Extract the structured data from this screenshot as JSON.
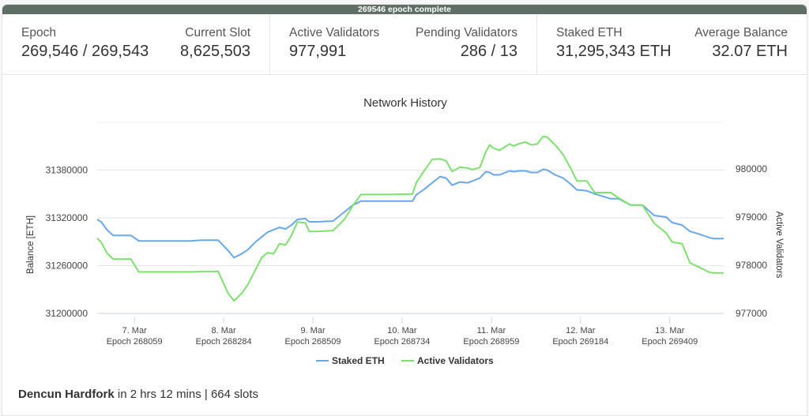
{
  "banner": {
    "text": "269546 epoch complete"
  },
  "stats": {
    "epoch": {
      "label": "Epoch",
      "value": "269,546 / 269,543"
    },
    "current_slot": {
      "label": "Current Slot",
      "value": "8,625,503"
    },
    "active_validators": {
      "label": "Active Validators",
      "value": "977,991"
    },
    "pending_validators": {
      "label": "Pending Validators",
      "value": "286 / 13"
    },
    "staked_eth": {
      "label": "Staked ETH",
      "value": "31,295,343 ETH"
    },
    "average_balance": {
      "label": "Average Balance",
      "value": "32.07 ETH"
    }
  },
  "footer": {
    "event": "Dencun Hardfork",
    "countdown": " in 2 hrs 12 mins",
    "separator": " | ",
    "slots": "664 slots"
  },
  "chart_data": {
    "type": "line",
    "title": "Network History",
    "xlabel": "",
    "ylabel": "Balance [ETH]",
    "y2label": "Active Validators",
    "grid": true,
    "legend_position": "bottom-center",
    "x_ticks": [
      {
        "date": "7. Mar",
        "epoch": "Epoch 268059",
        "value": 268059
      },
      {
        "date": "8. Mar",
        "epoch": "Epoch 268284",
        "value": 268284
      },
      {
        "date": "9. Mar",
        "epoch": "Epoch 268509",
        "value": 268509
      },
      {
        "date": "10. Mar",
        "epoch": "Epoch 268734",
        "value": 268734
      },
      {
        "date": "11. Mar",
        "epoch": "Epoch 268959",
        "value": 268959
      },
      {
        "date": "12. Mar",
        "epoch": "Epoch 269184",
        "value": 269184
      },
      {
        "date": "13. Mar",
        "epoch": "Epoch 269409",
        "value": 269409
      }
    ],
    "xlim": [
      267965,
      269545
    ],
    "ylim": [
      31195000,
      31440000
    ],
    "y_ticks": [
      31200000,
      31260000,
      31320000,
      31380000
    ],
    "y2lim": [
      976917,
      980970
    ],
    "y2_ticks": [
      977000,
      978000,
      979000,
      980000
    ],
    "series": [
      {
        "name": "Staked ETH",
        "axis": "left",
        "color": "#6aa7e8",
        "x": [
          267965,
          267975,
          267990,
          268005,
          268020,
          268050,
          268070,
          268090,
          268140,
          268200,
          268230,
          268270,
          268295,
          268310,
          268330,
          268345,
          268365,
          268380,
          268395,
          268410,
          268425,
          268440,
          268455,
          268470,
          268490,
          268500,
          268520,
          268560,
          268570,
          268590,
          268610,
          268630,
          268650,
          268670,
          268700,
          268760,
          268770,
          268790,
          268810,
          268830,
          268845,
          268860,
          268880,
          268900,
          268910,
          268930,
          268945,
          268955,
          268965,
          268980,
          269005,
          269015,
          269030,
          269045,
          269060,
          269075,
          269090,
          269100,
          269120,
          269140,
          269160,
          269175,
          269185,
          269200,
          269220,
          269260,
          269280,
          269310,
          269340,
          269370,
          269400,
          269415,
          269440,
          269460,
          269480,
          269510,
          269520,
          269545
        ],
        "values": [
          31318000,
          31315000,
          31305000,
          31298000,
          31298000,
          31298000,
          31291000,
          31291000,
          31291000,
          31291000,
          31292000,
          31292000,
          31279000,
          31270000,
          31275000,
          31280000,
          31290000,
          31296000,
          31302000,
          31305000,
          31308000,
          31306000,
          31311000,
          31318000,
          31319000,
          31315000,
          31315000,
          31316000,
          31320000,
          31328000,
          31336000,
          31341000,
          31341000,
          31341000,
          31341000,
          31341000,
          31349000,
          31356000,
          31364000,
          31372000,
          31370000,
          31361000,
          31365000,
          31364000,
          31366000,
          31370000,
          31378000,
          31377000,
          31374000,
          31374000,
          31379000,
          31378000,
          31379000,
          31379000,
          31377000,
          31377000,
          31381000,
          31380000,
          31374000,
          31370000,
          31362000,
          31355000,
          31355000,
          31354000,
          31350000,
          31344000,
          31344000,
          31336000,
          31336000,
          31323000,
          31321000,
          31314000,
          31311000,
          31303000,
          31300000,
          31295000,
          31294000,
          31294000
        ]
      },
      {
        "name": "Active Validators",
        "axis": "right",
        "color": "#7ee06e",
        "x": [
          267965,
          267975,
          267990,
          268005,
          268020,
          268050,
          268070,
          268090,
          268140,
          268200,
          268230,
          268270,
          268295,
          268310,
          268330,
          268345,
          268365,
          268380,
          268395,
          268410,
          268425,
          268440,
          268455,
          268470,
          268490,
          268500,
          268520,
          268560,
          268570,
          268590,
          268610,
          268630,
          268650,
          268670,
          268700,
          268760,
          268770,
          268790,
          268810,
          268830,
          268845,
          268860,
          268880,
          268900,
          268910,
          268930,
          268945,
          268955,
          268965,
          268980,
          269005,
          269015,
          269030,
          269045,
          269060,
          269075,
          269090,
          269100,
          269120,
          269140,
          269160,
          269175,
          269185,
          269200,
          269220,
          269260,
          269280,
          269310,
          269340,
          269370,
          269400,
          269415,
          269440,
          269460,
          269480,
          269510,
          269520,
          269545
        ],
        "values": [
          978560,
          978480,
          978250,
          978130,
          978130,
          978130,
          977860,
          977860,
          977860,
          977860,
          977870,
          977870,
          977420,
          977260,
          977420,
          977600,
          977920,
          978160,
          978260,
          978240,
          978450,
          978420,
          978620,
          978900,
          978880,
          978700,
          978700,
          978720,
          978800,
          978970,
          979240,
          979470,
          979470,
          979470,
          979470,
          979480,
          979720,
          979970,
          980200,
          980210,
          980170,
          979950,
          980040,
          980020,
          979990,
          980030,
          980360,
          980500,
          980430,
          980390,
          980520,
          980480,
          980530,
          980560,
          980500,
          980520,
          980680,
          980660,
          980500,
          980300,
          980000,
          979750,
          979750,
          979750,
          979510,
          979510,
          979400,
          979250,
          979250,
          978870,
          978670,
          978480,
          978450,
          978050,
          977970,
          977850,
          977840,
          977840
        ]
      }
    ]
  }
}
